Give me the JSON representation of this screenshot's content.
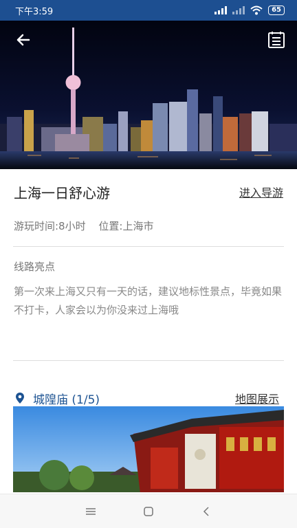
{
  "status_bar": {
    "time": "下午3:59",
    "battery": "65"
  },
  "route": {
    "title": "上海一日舒心游",
    "enter_guide": "进入导游",
    "duration": "游玩时间:8小时",
    "location": "位置:上海市"
  },
  "highlights": {
    "label": "线路亮点",
    "description": "第一次来上海又只有一天的话，建议地标性景点，毕竟如果不打卡，人家会以为你没来过上海哦"
  },
  "poi": {
    "name": "城隍庙 (1/5)",
    "map_show": "地图展示"
  },
  "colors": {
    "status_bar": "#1d4f91",
    "accent": "#1d5392"
  },
  "icons": {
    "back": "arrow-left-icon",
    "menu": "list-icon",
    "location": "location-pin-icon",
    "nav_menu": "hamburger-icon",
    "nav_home": "square-icon",
    "nav_back": "chevron-left-icon"
  }
}
